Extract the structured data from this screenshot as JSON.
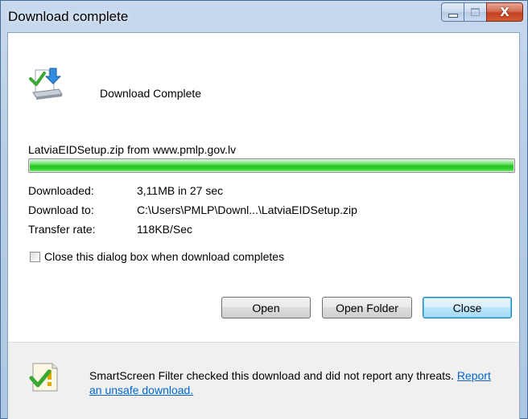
{
  "window": {
    "title": "Download complete",
    "minimize_icon": "minimize-icon",
    "maximize_icon": "maximize-icon",
    "close_glyph": "X"
  },
  "header": {
    "icon": "download-complete-icon",
    "text": "Download Complete"
  },
  "download": {
    "file_line": "LatviaEIDSetup.zip from www.pmlp.gov.lv",
    "progress": 1.0,
    "rows": [
      {
        "label": "Downloaded:",
        "value": "3,11MB in 27 sec"
      },
      {
        "label": "Download to:",
        "value": "C:\\Users\\PMLP\\Downl...\\LatviaEIDSetup.zip"
      },
      {
        "label": "Transfer rate:",
        "value": "118KB/Sec"
      }
    ]
  },
  "options": {
    "close_when_complete_label": "Close this dialog box when download completes",
    "close_when_complete_checked": false
  },
  "buttons": {
    "open": "Open",
    "open_folder": "Open Folder",
    "close": "Close"
  },
  "footer": {
    "icon": "smartscreen-check-icon",
    "text": "SmartScreen Filter checked this download and did not report any threats.",
    "link": "Report an unsafe download."
  },
  "colors": {
    "progress_green": "#24c11f",
    "link_blue": "#0066cc",
    "titlebar": "#b7cde6"
  }
}
